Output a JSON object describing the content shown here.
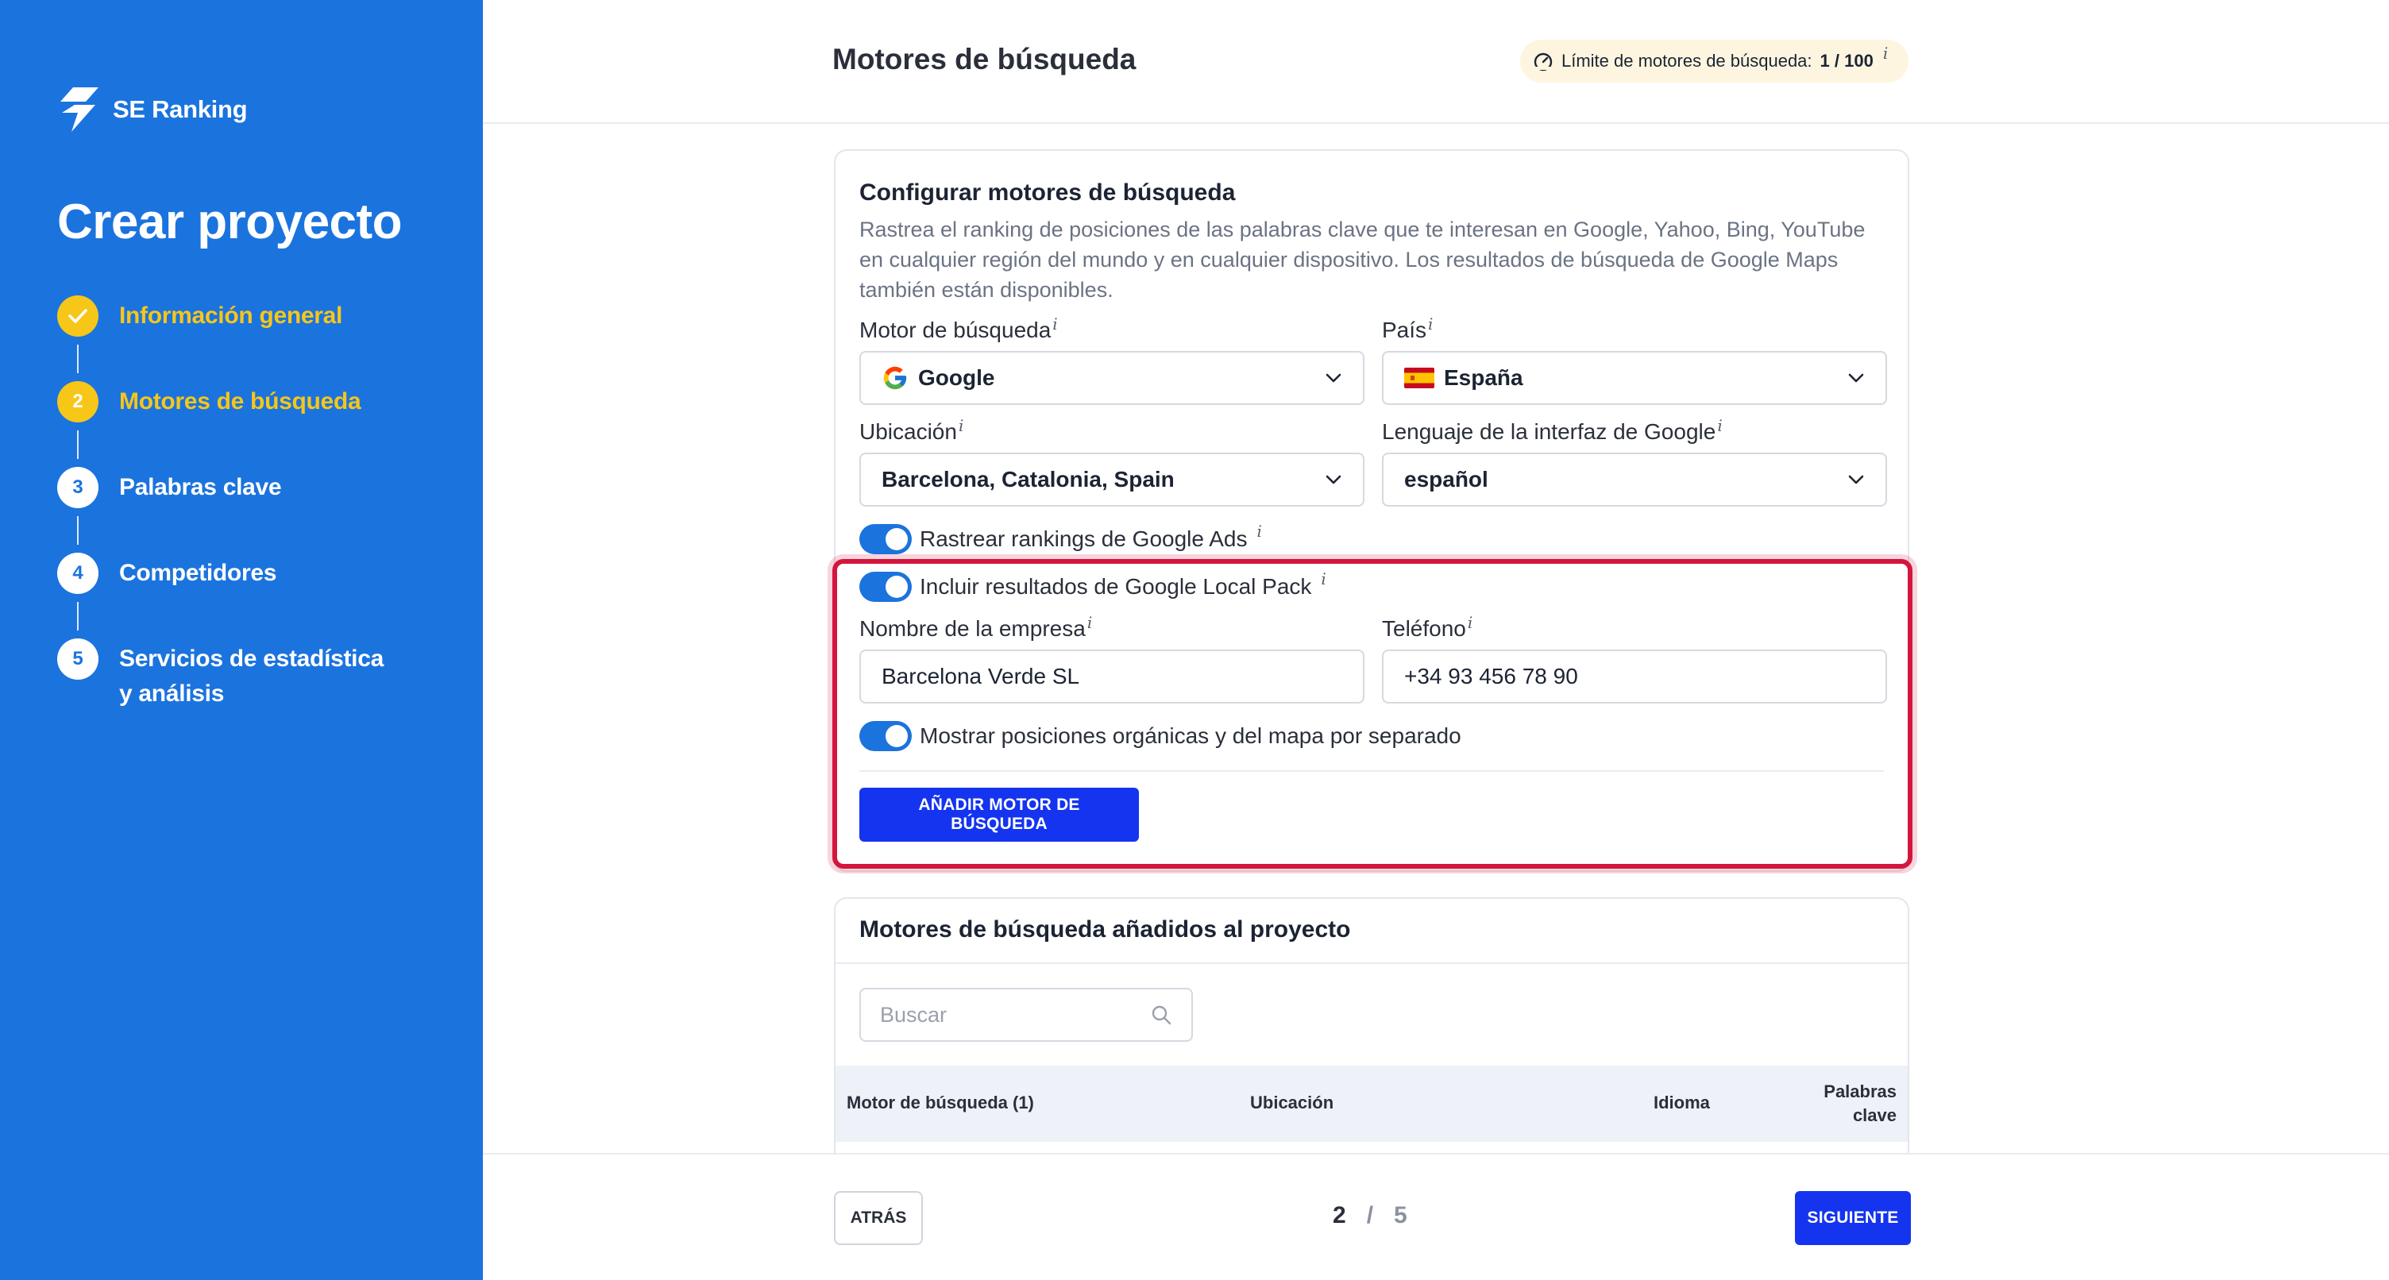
{
  "sidebar": {
    "brand": "SE Ranking",
    "title": "Crear proyecto",
    "steps": [
      {
        "number": "✓",
        "label": "Información general",
        "state": "done"
      },
      {
        "number": "2",
        "label": "Motores de búsqueda",
        "state": "active"
      },
      {
        "number": "3",
        "label": "Palabras clave",
        "state": "pending"
      },
      {
        "number": "4",
        "label": "Competidores",
        "state": "pending"
      },
      {
        "number": "5",
        "label": "Servicios de estadística y análisis",
        "state": "pending"
      }
    ]
  },
  "header": {
    "title": "Motores de búsqueda",
    "limit_label": "Límite de motores de búsqueda:",
    "limit_value": "1 / 100",
    "info": "i"
  },
  "config": {
    "title": "Configurar motores de búsqueda",
    "description": "Rastrea el ranking de posiciones de las palabras clave que te interesan en Google, Yahoo, Bing, YouTube en cualquier región del mundo y en cualquier dispositivo. Los resultados de búsqueda de Google Maps también están disponibles.",
    "engine_label": "Motor de búsqueda",
    "engine_value": "Google",
    "country_label": "País",
    "country_value": "España",
    "location_label": "Ubicación",
    "location_value": "Barcelona, Catalonia, Spain",
    "language_label": "Lenguaje de la interfaz de Google",
    "language_value": "español",
    "toggle_ads": "Rastrear rankings de Google Ads",
    "toggle_local_pack": "Incluir resultados de Google Local Pack",
    "company_label": "Nombre de la empresa",
    "company_value": "Barcelona Verde SL",
    "phone_label": "Teléfono",
    "phone_value": "+34 93 456 78 90",
    "toggle_separate": "Mostrar posiciones orgánicas y del mapa por separado",
    "add_button": "AÑADIR MOTOR DE BÚSQUEDA"
  },
  "added": {
    "title": "Motores de búsqueda añadidos al proyecto",
    "search_placeholder": "Buscar",
    "columns": {
      "engine": "Motor de búsqueda (1)",
      "location": "Ubicación",
      "language": "Idioma",
      "keywords_1": "Palabras",
      "keywords_2": "clave"
    }
  },
  "footer": {
    "back": "ATRÁS",
    "current_page": "2",
    "separator": "/",
    "total_pages": "5",
    "next": "SIGUIENTE"
  },
  "colors": {
    "sidebar_bg": "#1b73de",
    "step_active": "#f6c619",
    "primary_button": "#1434f0",
    "highlight_border": "#d3163e"
  },
  "icons": [
    "brand-logo-icon",
    "check-icon",
    "gauge-icon",
    "google-icon",
    "spain-flag-icon",
    "chevron-down-icon",
    "search-icon"
  ]
}
